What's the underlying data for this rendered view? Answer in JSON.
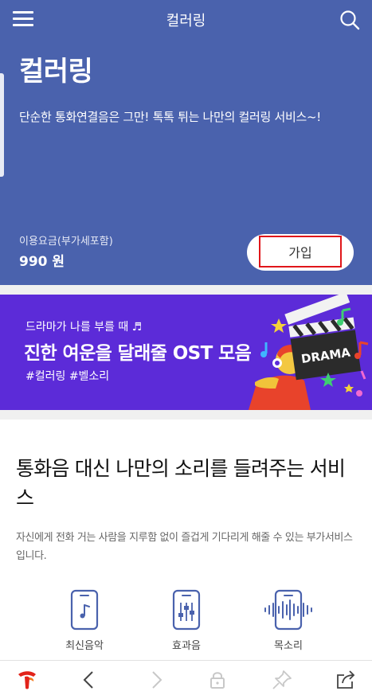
{
  "header": {
    "title": "컬러링",
    "menu_icon": "hamburger-menu-icon",
    "search_icon": "search-icon"
  },
  "hero": {
    "title": "컬러링",
    "description": "단순한 통화연결음은 그만! 톡톡 튀는 나만의 컬러링 서비스~!",
    "fee_label": "이용요금(부가세포함)",
    "fee_value": "990 원",
    "join_label": "가입",
    "background_color": "#4a62ad",
    "highlight_color": "#e0161a"
  },
  "banner": {
    "subtitle": "드라마가 나를 부를 때 ♬",
    "title": "진한 여운을 달래줄 OST 모음",
    "tags": "#컬러링  #벨소리",
    "art_text": "DRAMA",
    "background_color": "#5c2bd8"
  },
  "intro": {
    "title": "통화음 대신 나만의 소리를 들려주는 서비스",
    "description": "자신에게 전화 거는 사람을 지루함 없이 즐겁게 기다리게 해줄 수 있는 부가서비스입니다."
  },
  "features": [
    {
      "label": "최신음악",
      "icon": "phone-music-note-icon"
    },
    {
      "label": "효과음",
      "icon": "phone-equalizer-icon"
    },
    {
      "label": "목소리",
      "icon": "phone-soundwave-icon"
    }
  ],
  "toolbar": {
    "items": [
      "t-logo-icon",
      "back-icon",
      "forward-icon",
      "lock-icon",
      "pin-icon",
      "share-icon"
    ]
  }
}
